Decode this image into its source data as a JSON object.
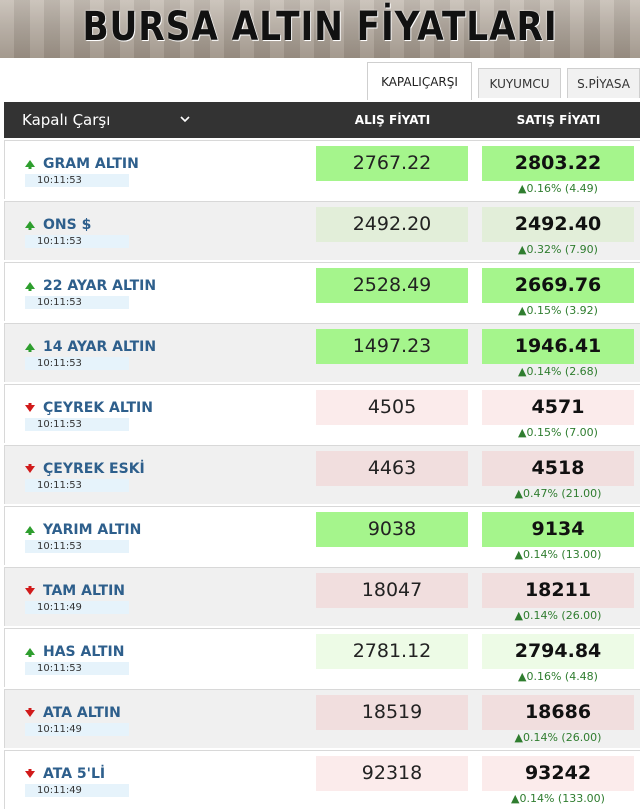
{
  "banner": {
    "title": "BURSA ALTIN FİYATLARI"
  },
  "tabs": [
    "KAPALIÇARŞI",
    "KUYUMCU",
    "S.PİYASA"
  ],
  "header": {
    "market": "Kapalı Çarşı",
    "buy_label": "ALIŞ FİYATI",
    "sell_label": "SATIŞ FİYATI"
  },
  "colors": {
    "up_arrow": "#2e9e2e",
    "down_arrow": "#d11a1a",
    "name_text": "#2e5f8c",
    "header_bg": "#333333"
  },
  "rows": [
    {
      "name": "GRAM ALTIN",
      "time": "10:11:53",
      "buy": "2767.22",
      "sell": "2803.22",
      "change": "▲0.16% (4.49)",
      "direction": "up"
    },
    {
      "name": "ONS $",
      "time": "10:11:53",
      "buy": "2492.20",
      "sell": "2492.40",
      "change": "▲0.32% (7.90)",
      "direction": "up"
    },
    {
      "name": "22 AYAR ALTIN",
      "time": "10:11:53",
      "buy": "2528.49",
      "sell": "2669.76",
      "change": "▲0.15% (3.92)",
      "direction": "up"
    },
    {
      "name": "14 AYAR ALTIN",
      "time": "10:11:53",
      "buy": "1497.23",
      "sell": "1946.41",
      "change": "▲0.14% (2.68)",
      "direction": "up"
    },
    {
      "name": "ÇEYREK ALTIN",
      "time": "10:11:53",
      "buy": "4505",
      "sell": "4571",
      "change": "▲0.15% (7.00)",
      "direction": "down"
    },
    {
      "name": "ÇEYREK ESKİ",
      "time": "10:11:53",
      "buy": "4463",
      "sell": "4518",
      "change": "▲0.47% (21.00)",
      "direction": "down"
    },
    {
      "name": "YARIM ALTIN",
      "time": "10:11:53",
      "buy": "9038",
      "sell": "9134",
      "change": "▲0.14% (13.00)",
      "direction": "up"
    },
    {
      "name": "TAM ALTIN",
      "time": "10:11:49",
      "buy": "18047",
      "sell": "18211",
      "change": "▲0.14% (26.00)",
      "direction": "down"
    },
    {
      "name": "HAS ALTIN",
      "time": "10:11:53",
      "buy": "2781.12",
      "sell": "2794.84",
      "change": "▲0.16% (4.48)",
      "direction": "up"
    },
    {
      "name": "ATA ALTIN",
      "time": "10:11:49",
      "buy": "18519",
      "sell": "18686",
      "change": "▲0.14% (26.00)",
      "direction": "down"
    },
    {
      "name": "ATA 5'Lİ",
      "time": "10:11:49",
      "buy": "92318",
      "sell": "93242",
      "change": "▲0.14% (133.00)",
      "direction": "down"
    }
  ]
}
